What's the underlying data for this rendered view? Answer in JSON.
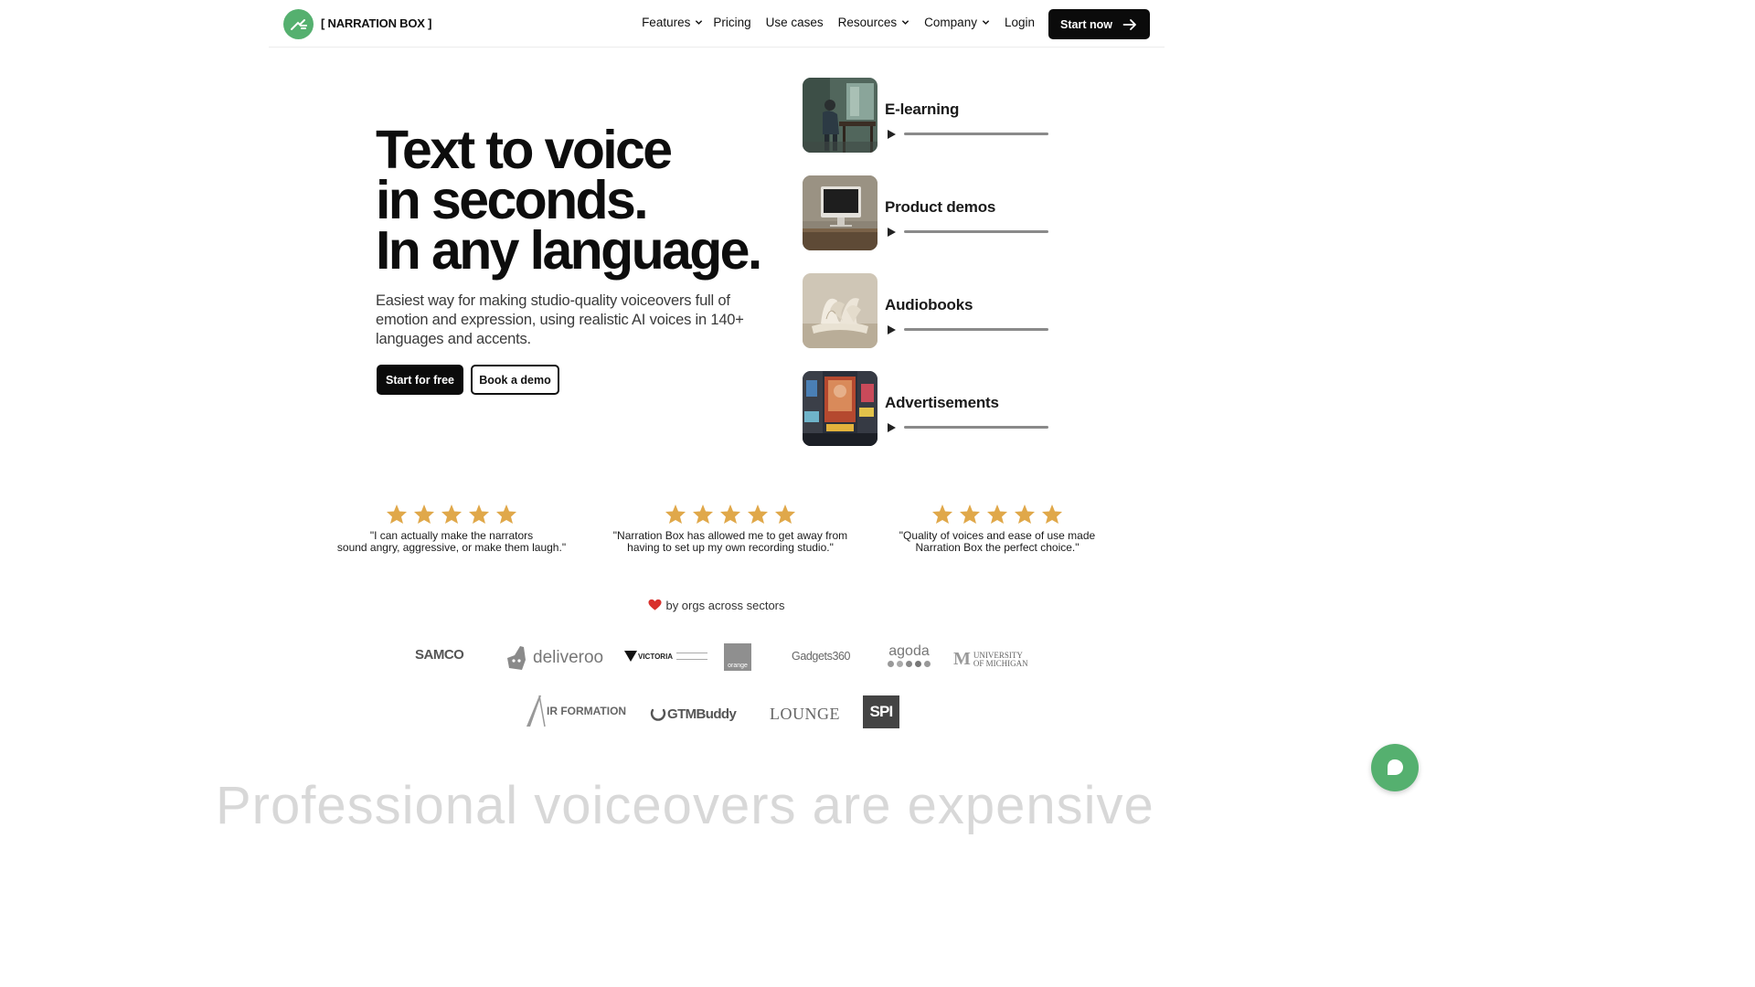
{
  "brand": {
    "name": "[ NARRATION BOX ]",
    "accent": "#55b06f"
  },
  "nav": {
    "items": [
      {
        "label": "Features",
        "dropdown": true
      },
      {
        "label": "Pricing",
        "dropdown": false
      },
      {
        "label": "Use cases",
        "dropdown": false
      },
      {
        "label": "Resources",
        "dropdown": true
      },
      {
        "label": "Company",
        "dropdown": true
      },
      {
        "label": "Login",
        "dropdown": false
      }
    ],
    "cta": "Start now"
  },
  "hero": {
    "title_lines": [
      "Text to voice",
      "in seconds.",
      "In any language."
    ],
    "subtitle": "Easiest way for making studio-quality voiceovers full of emotion and expression, using realistic AI voices in 140+ languages and accents.",
    "primary_button": "Start for free",
    "secondary_button": "Book a demo"
  },
  "use_cases": [
    {
      "title": "E-learning",
      "icon": "play-icon"
    },
    {
      "title": "Product demos",
      "icon": "play-icon"
    },
    {
      "title": "Audiobooks",
      "icon": "play-icon"
    },
    {
      "title": "Advertisements",
      "icon": "play-icon"
    }
  ],
  "testimonials": [
    {
      "rating": 5,
      "quote": "\"I can actually make the narrators\nsound angry, aggressive, or make them laugh.\""
    },
    {
      "rating": 5,
      "quote": "\"Narration Box has allowed me to get away from\nhaving to set up my own recording studio.\""
    },
    {
      "rating": 5,
      "quote": "\"Quality of voices and ease of use made\nNarration Box the perfect choice.\""
    }
  ],
  "loved_by": "by orgs across sectors",
  "logos": {
    "row1": [
      "SAMCO",
      "deliveroo",
      "VICTORIA",
      "orange",
      "Gadgets360",
      "agoda",
      "UNIVERSITY OF MICHIGAN"
    ],
    "row2": [
      "IR FORMATION",
      "GTMBuddy",
      "LOUNGE",
      "SPI"
    ]
  },
  "next_section_heading": "Professional voiceovers are expensive",
  "colors": {
    "star": "#e0a84a",
    "dark": "#0b0b0b",
    "heart": "#d9302c"
  }
}
